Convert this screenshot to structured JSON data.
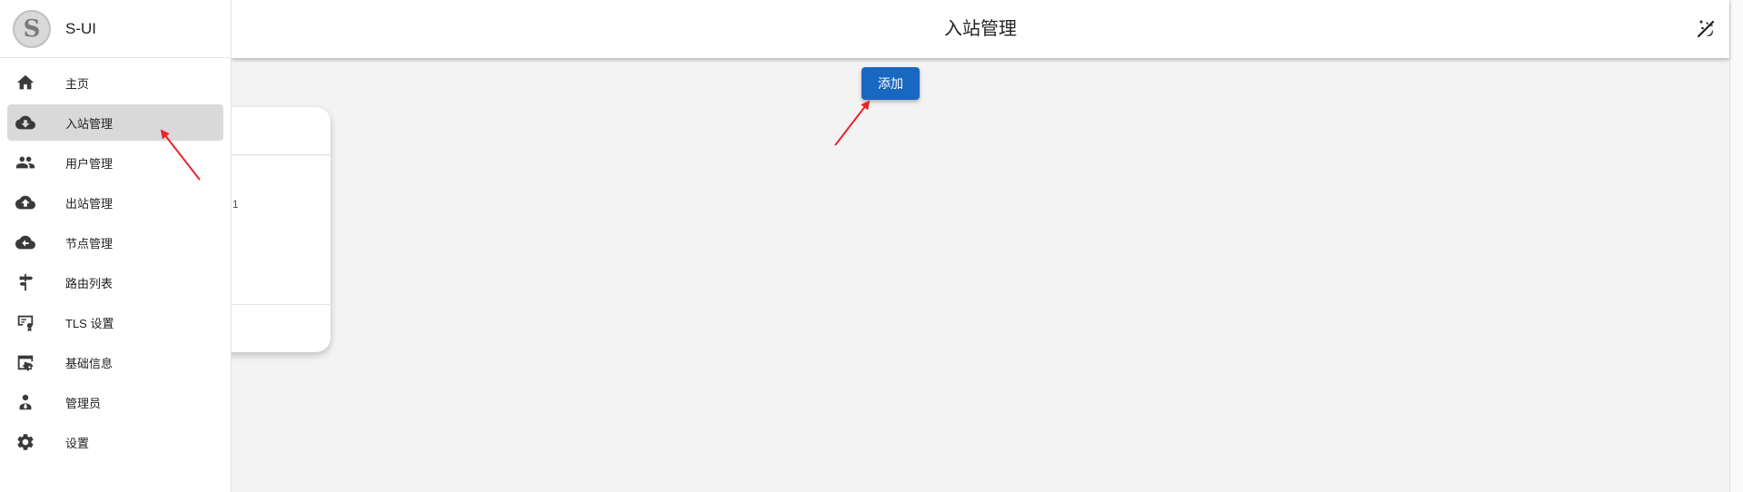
{
  "sidebar": {
    "brand": {
      "logo_letter": "S",
      "title": "S-UI"
    },
    "items": [
      {
        "label": "主页",
        "icon": "home-icon",
        "active": false
      },
      {
        "label": "入站管理",
        "icon": "cloud-download-icon",
        "active": true
      },
      {
        "label": "用户管理",
        "icon": "users-icon",
        "active": false
      },
      {
        "label": "出站管理",
        "icon": "cloud-upload-icon",
        "active": false
      },
      {
        "label": "节点管理",
        "icon": "cloud-sync-icon",
        "active": false
      },
      {
        "label": "路由列表",
        "icon": "signpost-icon",
        "active": false
      },
      {
        "label": "TLS 设置",
        "icon": "certificate-icon",
        "active": false
      },
      {
        "label": "基础信息",
        "icon": "web-settings-icon",
        "active": false
      },
      {
        "label": "管理员",
        "icon": "admin-icon",
        "active": false
      },
      {
        "label": "设置",
        "icon": "gear-icon",
        "active": false
      }
    ]
  },
  "header": {
    "title": "入站管理",
    "theme_icon": "theme-toggle-icon"
  },
  "main": {
    "add_button_label": "添加",
    "card_fragment": "1"
  },
  "colors": {
    "primary": "#1867c0",
    "active_bg": "#d9d9d9",
    "annotation": "#e8252b"
  }
}
